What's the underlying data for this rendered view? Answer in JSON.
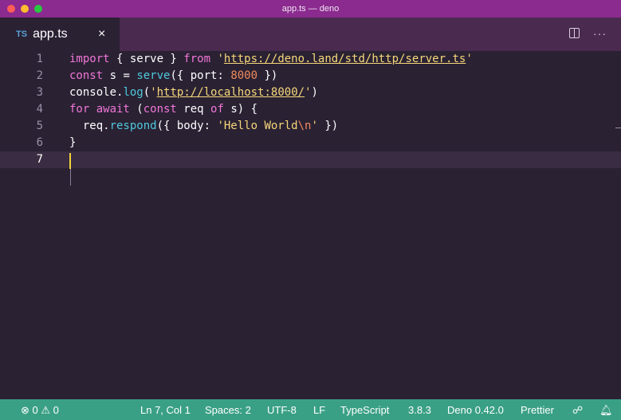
{
  "window": {
    "title": "app.ts — deno"
  },
  "tab": {
    "icon_text": "TS",
    "label": "app.ts",
    "close": "×"
  },
  "editor_actions": {
    "split": "split-editor-icon",
    "more": "···"
  },
  "editor": {
    "lines": [
      {
        "number": "1",
        "tokens": [
          {
            "t": "import",
            "c": "kw"
          },
          {
            "t": " { serve } ",
            "c": "plain"
          },
          {
            "t": "from",
            "c": "kw"
          },
          {
            "t": " ",
            "c": "plain"
          },
          {
            "t": "'",
            "c": "str"
          },
          {
            "t": "https://deno.land/std/http/server.ts",
            "c": "url"
          },
          {
            "t": "'",
            "c": "str"
          }
        ]
      },
      {
        "number": "2",
        "tokens": [
          {
            "t": "const",
            "c": "kw"
          },
          {
            "t": " s = ",
            "c": "plain"
          },
          {
            "t": "serve",
            "c": "fn"
          },
          {
            "t": "({ port: ",
            "c": "plain"
          },
          {
            "t": "8000",
            "c": "num"
          },
          {
            "t": " })",
            "c": "plain"
          }
        ]
      },
      {
        "number": "3",
        "tokens": [
          {
            "t": "console",
            "c": "plain"
          },
          {
            "t": ".",
            "c": "plain"
          },
          {
            "t": "log",
            "c": "fn"
          },
          {
            "t": "(",
            "c": "plain"
          },
          {
            "t": "'",
            "c": "str"
          },
          {
            "t": "http://localhost:8000/",
            "c": "url"
          },
          {
            "t": "'",
            "c": "str"
          },
          {
            "t": ")",
            "c": "plain"
          }
        ]
      },
      {
        "number": "4",
        "tokens": [
          {
            "t": "for await",
            "c": "kw"
          },
          {
            "t": " (",
            "c": "plain"
          },
          {
            "t": "const",
            "c": "kw"
          },
          {
            "t": " req ",
            "c": "plain"
          },
          {
            "t": "of",
            "c": "kw"
          },
          {
            "t": " s) {",
            "c": "plain"
          }
        ]
      },
      {
        "number": "5",
        "tokens": [
          {
            "t": "  req.",
            "c": "plain"
          },
          {
            "t": "respond",
            "c": "method"
          },
          {
            "t": "({ body: ",
            "c": "plain"
          },
          {
            "t": "'Hello World",
            "c": "str"
          },
          {
            "t": "\\n",
            "c": "esc"
          },
          {
            "t": "'",
            "c": "str"
          },
          {
            "t": " })",
            "c": "plain"
          }
        ]
      },
      {
        "number": "6",
        "tokens": [
          {
            "t": "}",
            "c": "plain"
          }
        ]
      },
      {
        "number": "7",
        "tokens": []
      }
    ]
  },
  "status": {
    "problems": "⊗ 0 ⚠ 0",
    "position": "Ln 7, Col 1",
    "spaces": "Spaces: 2",
    "encoding": "UTF-8",
    "eol": "LF",
    "language": "TypeScript",
    "ts_version": "3.8.3",
    "deno": "Deno 0.42.0",
    "formatter": "Prettier",
    "feedback_icon": "☍",
    "bell_icon": "🔔︎"
  },
  "colors": {
    "titlebar": "#8b2a8f",
    "tabbar": "#4a2a4f",
    "editor_bg": "#2a2133",
    "statusbar": "#3aa085"
  }
}
